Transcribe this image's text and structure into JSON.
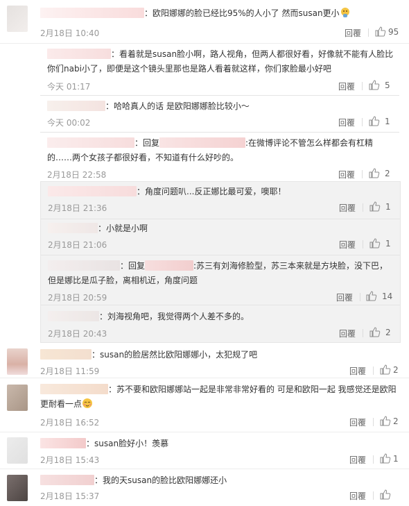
{
  "comments": [
    {
      "text": "：欧阳娜娜的脸已经比95%的人小了 然而susan更小",
      "time": "2月18日 10:40",
      "reply_label": "回覆",
      "likes": "95"
    },
    {
      "text": "：susan的脸居然比欧阳娜娜小，太犯规了吧",
      "time": "2月18日 11:59",
      "reply_label": "回覆",
      "likes": "2"
    },
    {
      "text_line1": "：苏不要和欧阳娜娜站一起是非常非常好看的 可是和欧阳一起 我感觉还是欧阳",
      "text_line2": "更耐看一点",
      "time": "2月18日 16:52",
      "reply_label": "回覆",
      "likes": "2"
    },
    {
      "text": "：susan脸好小！羡慕",
      "time": "2月18日 15:43",
      "reply_label": "回覆",
      "likes": "1"
    },
    {
      "text": "：我的天susan的脸比欧阳娜娜还小",
      "time": "2月18日 15:37",
      "reply_label": "回覆",
      "likes": ""
    }
  ],
  "replies_top": [
    {
      "text_line1": "：看着就是susan脸小啊，路人视角，但两人都很好看，好像就不能有人脸比",
      "text_line2": "你们nabi小了，即便是这个镜头里那也是路人看着就这样，你们家脸最小好吧",
      "time": "今天 01:17",
      "reply_label": "回覆",
      "likes": "5"
    },
    {
      "text": "：哈哈真人的话 是欧阳娜娜脸比较小～",
      "time": "今天 00:02",
      "reply_label": "回覆",
      "likes": "1"
    },
    {
      "text_prefix": "：回复",
      "text_suffix": ":在微博评论不管怎么样都会有杠精",
      "text_line2": "的……两个女孩子都很好看，不知道有什么好吵的。",
      "time": "2月18日 22:58",
      "reply_label": "回覆",
      "likes": "2"
    }
  ],
  "replies_box": [
    {
      "text": "：角度问题叭...反正娜比最可爱，噢耶！",
      "time": "2月18日 21:36",
      "reply_label": "回覆",
      "likes": "1"
    },
    {
      "text": "：小就是小啊",
      "time": "2月18日 21:06",
      "reply_label": "回覆",
      "likes": "1"
    },
    {
      "text_prefix": "：回复",
      "text_suffix": ":苏三有刘海修脸型，苏三本来就是方块脸，没下巴，",
      "text_line2": "但是娜比是瓜子脸，离相机近，角度问题",
      "time": "2月18日 20:59",
      "reply_label": "回覆",
      "likes": "14"
    },
    {
      "text": "：刘海视角吧，我觉得两个人差不多的。",
      "time": "2月18日 20:43",
      "reply_label": "回覆",
      "likes": "2"
    }
  ],
  "colors": {
    "time": "#999999",
    "mask_pink": "#f7dede",
    "mask_peach": "#f6e2d4"
  },
  "icons": {
    "like": "thumb-up-icon",
    "emoji_thinking": "thinking-emoji-icon",
    "emoji_blush": "blush-emoji-icon"
  }
}
